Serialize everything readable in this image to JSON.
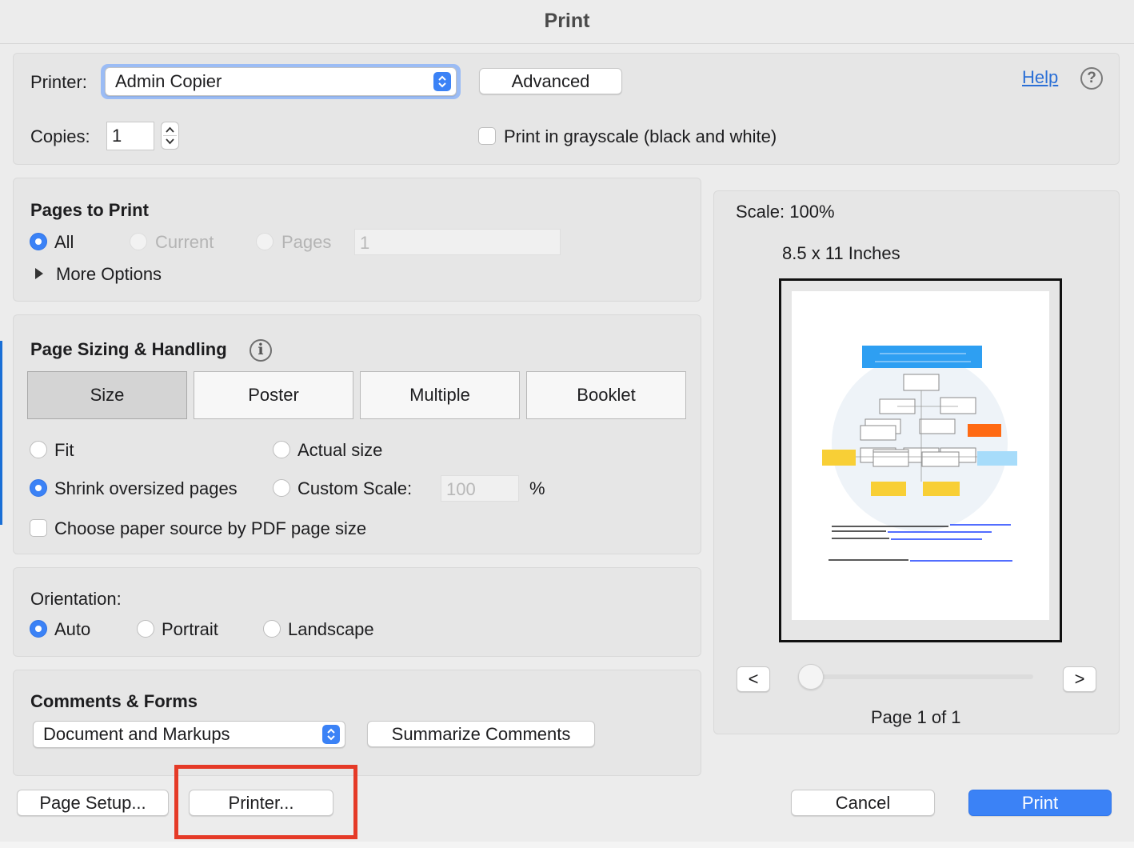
{
  "title": "Print",
  "printer": {
    "label": "Printer:",
    "selected": "Admin Copier",
    "advanced_label": "Advanced",
    "help_label": "Help",
    "help_icon": "?"
  },
  "copies": {
    "label": "Copies:",
    "value": "1"
  },
  "grayscale_label": "Print in grayscale (black and white)",
  "pages_to_print": {
    "heading": "Pages to Print",
    "all_label": "All",
    "current_label": "Current",
    "pages_label": "Pages",
    "pages_value": "1",
    "more_options_label": "More Options"
  },
  "page_sizing": {
    "heading": "Page Sizing & Handling",
    "info_icon": "i",
    "tabs": [
      "Size",
      "Poster",
      "Multiple",
      "Booklet"
    ],
    "fit_label": "Fit",
    "actual_size_label": "Actual size",
    "shrink_label": "Shrink oversized pages",
    "custom_scale_label": "Custom Scale:",
    "custom_scale_value": "100",
    "percent_label": "%",
    "paper_source_label": "Choose paper source by PDF page size"
  },
  "orientation": {
    "heading": "Orientation:",
    "auto_label": "Auto",
    "portrait_label": "Portrait",
    "landscape_label": "Landscape"
  },
  "comments_forms": {
    "heading": "Comments & Forms",
    "selected": "Document and Markups",
    "summarize_label": "Summarize Comments"
  },
  "preview": {
    "scale_label": "Scale: 100%",
    "paper_size_label": "8.5 x 11 Inches",
    "prev_label": "<",
    "next_label": ">",
    "page_indicator": "Page 1 of 1"
  },
  "footer": {
    "page_setup_label": "Page Setup...",
    "printer_label": "Printer...",
    "cancel_label": "Cancel",
    "print_label": "Print"
  },
  "colors": {
    "accent": "#3b82f6",
    "highlight": "#e53a27"
  }
}
